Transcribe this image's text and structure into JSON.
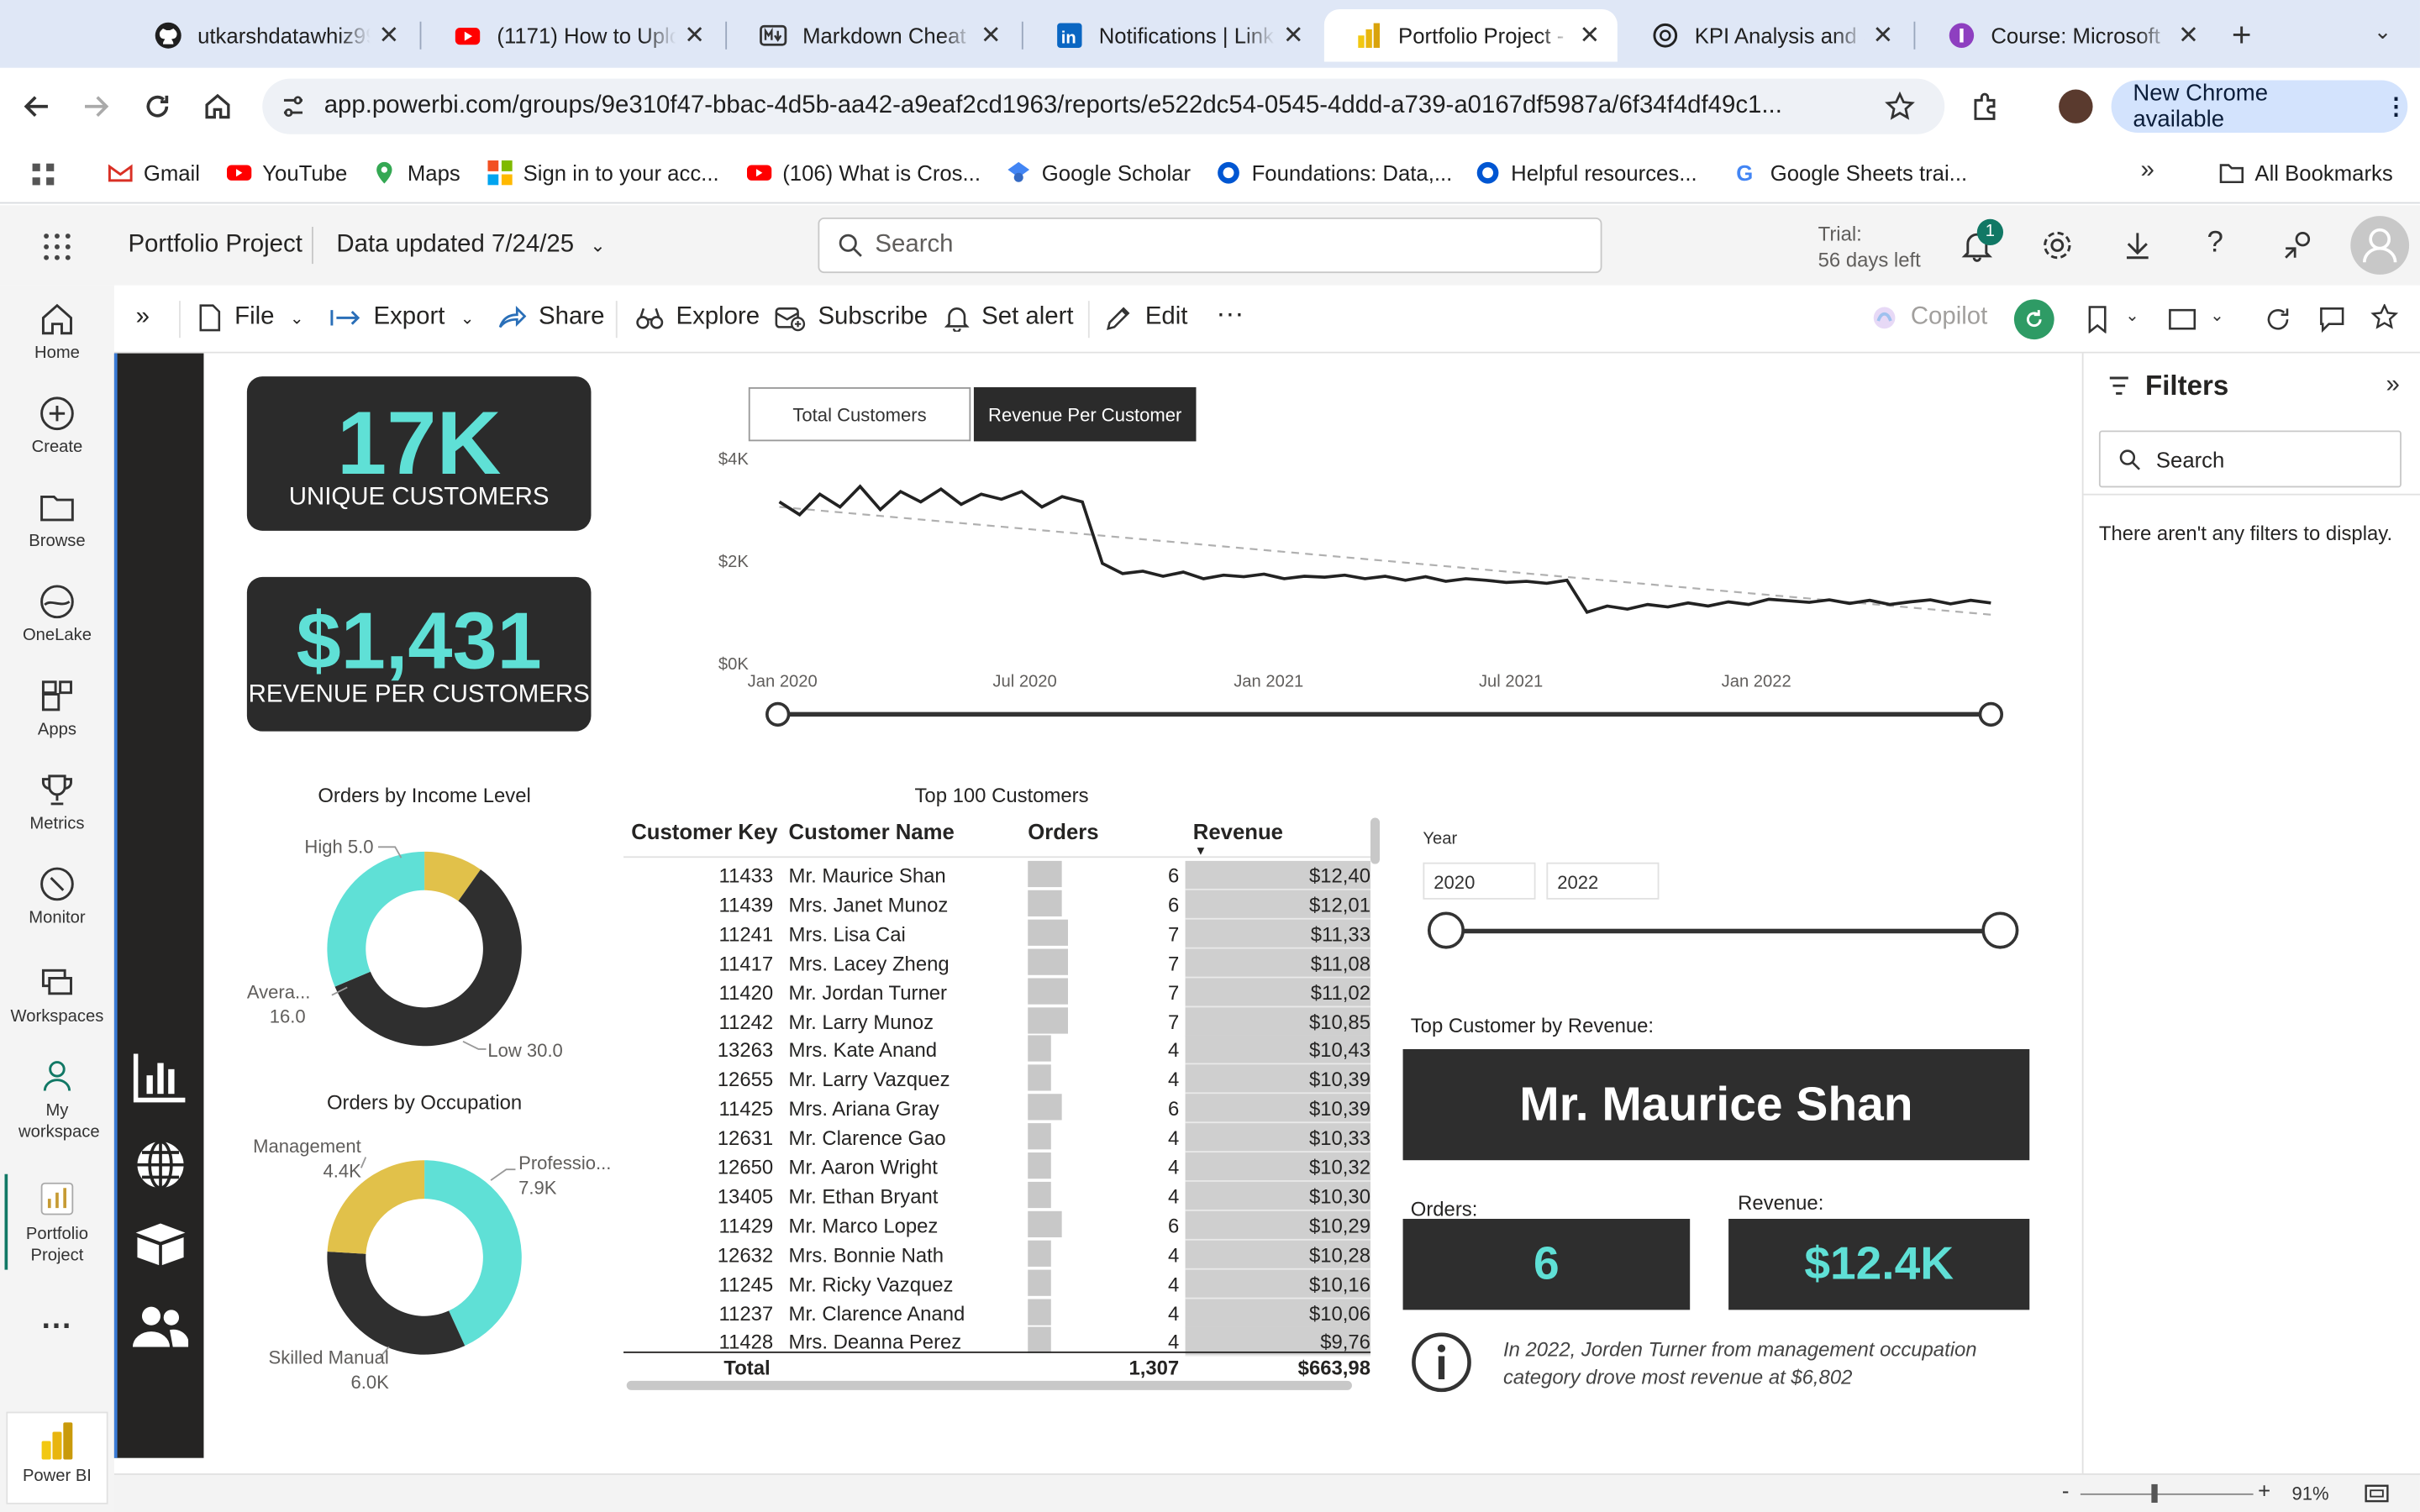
{
  "browser": {
    "tabs": [
      {
        "title": "utkarshdatawhiz99",
        "icon": "github-icon"
      },
      {
        "title": "(1171) How to Uplo",
        "icon": "youtube-icon"
      },
      {
        "title": "Markdown Cheat S",
        "icon": "markdown-icon"
      },
      {
        "title": "Notifications | Link",
        "icon": "linkedin-icon"
      },
      {
        "title": "Portfolio Project - P",
        "icon": "powerbi-icon",
        "active": true
      },
      {
        "title": "KPI Analysis and S",
        "icon": "openai-icon"
      },
      {
        "title": "Course: Microsoft",
        "icon": "course-icon"
      }
    ],
    "url": "app.powerbi.com/groups/9e310f47-bbac-4d5b-aa42-a9eaf2cd1963/reports/e522dc54-0545-4ddd-a739-a0167df5987a/6f34f4df49c1...",
    "new_chrome": "New Chrome available",
    "bookmarks": [
      "Gmail",
      "YouTube",
      "Maps",
      "Sign in to your acc...",
      "(106) What is Cros...",
      "Google Scholar",
      "Foundations: Data,...",
      "Helpful resources...",
      "Google Sheets trai..."
    ],
    "all_bookmarks": "All Bookmarks"
  },
  "pbi": {
    "workspace": "Portfolio Project",
    "data_updated": "Data updated 7/24/25",
    "search_placeholder": "Search",
    "trial_line1": "Trial:",
    "trial_line2": "56 days left",
    "notif_count": "1",
    "nav": [
      "Home",
      "Create",
      "Browse",
      "OneLake",
      "Apps",
      "Metrics",
      "Monitor",
      "Workspaces",
      "My workspace",
      "Portfolio Project",
      "Power BI"
    ],
    "toolbar": {
      "file": "File",
      "export": "Export",
      "share": "Share",
      "explore": "Explore",
      "subscribe": "Subscribe",
      "set_alert": "Set alert",
      "edit": "Edit",
      "copilot": "Copilot"
    }
  },
  "report": {
    "kpi1": {
      "value": "17K",
      "label": "UNIQUE CUSTOMERS"
    },
    "kpi2": {
      "value": "$1,431",
      "label": "REVENUE PER CUSTOMERS"
    },
    "toggle": {
      "left": "Total Customers",
      "right": "Revenue Per Customer"
    },
    "donut1": {
      "title": "Orders by Income Level",
      "slices": [
        {
          "name": "High",
          "value": 5.0,
          "label": "High 5.0",
          "color": "#e1c14a"
        },
        {
          "name": "Low",
          "value": 30.0,
          "label": "Low 30.0",
          "color": "#2f2f2f"
        },
        {
          "name": "Average",
          "value": 16.0,
          "label_a": "Avera...",
          "label_b": "16.0",
          "color": "#5fe0d6"
        }
      ]
    },
    "donut2": {
      "title": "Orders by Occupation",
      "slices": [
        {
          "name": "Professional",
          "value": 7.9,
          "label_a": "Professio...",
          "label_b": "7.9K",
          "color": "#5fe0d6"
        },
        {
          "name": "Skilled Manual",
          "value": 6.0,
          "label_a": "Skilled Manual",
          "label_b": "6.0K",
          "color": "#2f2f2f"
        },
        {
          "name": "Management",
          "value": 4.4,
          "label_a": "Management",
          "label_b": "4.4K",
          "color": "#e1c14a"
        }
      ]
    },
    "table": {
      "title": "Top 100 Customers",
      "headers": [
        "Customer Key",
        "Customer Name",
        "Orders",
        "Revenue"
      ],
      "rows": [
        [
          "11433",
          "Mr. Maurice Shan",
          "6",
          "$12,40"
        ],
        [
          "11439",
          "Mrs. Janet Munoz",
          "6",
          "$12,01"
        ],
        [
          "11241",
          "Mrs. Lisa Cai",
          "7",
          "$11,33"
        ],
        [
          "11417",
          "Mrs. Lacey Zheng",
          "7",
          "$11,08"
        ],
        [
          "11420",
          "Mr. Jordan Turner",
          "7",
          "$11,02"
        ],
        [
          "11242",
          "Mr. Larry Munoz",
          "7",
          "$10,85"
        ],
        [
          "13263",
          "Mrs. Kate Anand",
          "4",
          "$10,43"
        ],
        [
          "12655",
          "Mr. Larry Vazquez",
          "4",
          "$10,39"
        ],
        [
          "11425",
          "Mrs. Ariana Gray",
          "6",
          "$10,39"
        ],
        [
          "12631",
          "Mr. Clarence Gao",
          "4",
          "$10,33"
        ],
        [
          "12650",
          "Mr. Aaron Wright",
          "4",
          "$10,32"
        ],
        [
          "13405",
          "Mr. Ethan Bryant",
          "4",
          "$10,30"
        ],
        [
          "11429",
          "Mr. Marco Lopez",
          "6",
          "$10,29"
        ],
        [
          "12632",
          "Mrs. Bonnie Nath",
          "4",
          "$10,28"
        ],
        [
          "11245",
          "Mr. Ricky Vazquez",
          "4",
          "$10,16"
        ],
        [
          "11237",
          "Mr. Clarence Anand",
          "4",
          "$10,06"
        ],
        [
          "11428",
          "Mrs. Deanna Perez",
          "4",
          "$9,76"
        ]
      ],
      "total_label": "Total",
      "total_orders": "1,307",
      "total_revenue": "$663,98"
    },
    "year_slicer": {
      "label": "Year",
      "from": "2020",
      "to": "2022"
    },
    "top_customer_label": "Top Customer by Revenue:",
    "top_customer": "Mr. Maurice Shan",
    "orders_label": "Orders:",
    "orders_value": "6",
    "revenue_label": "Revenue:",
    "revenue_value": "$12.4K",
    "insight": "In 2022, Jorden Turner from management occupation category drove most revenue at $6,802"
  },
  "filters": {
    "title": "Filters",
    "search": "Search",
    "empty": "There aren't any filters to display."
  },
  "status": {
    "zoom": "91%"
  },
  "chart_data": {
    "type": "line",
    "series": [
      {
        "values": [
          3150,
          2900,
          3300,
          3050,
          3450,
          3000,
          3350,
          3150,
          3400,
          3100,
          3300,
          3200,
          3350,
          3050,
          3250,
          3150,
          1950,
          1750,
          1800,
          1700,
          1780,
          1650,
          1720,
          1690,
          1740,
          1650,
          1700,
          1680,
          1720,
          1650,
          1700,
          1620,
          1690,
          1600,
          1650,
          1620,
          1580,
          1600,
          1560,
          1620,
          1000,
          1120,
          1060,
          1150,
          1100,
          1180,
          1120,
          1200,
          1150,
          1250,
          1220,
          1190,
          1240,
          1170,
          1230,
          1150,
          1200,
          1240,
          1160,
          1230,
          1180
        ]
      }
    ],
    "trend": [
      3050,
      950
    ],
    "x_ticks": [
      "Jan 2020",
      "Jul 2020",
      "Jan 2021",
      "Jul 2021",
      "Jan 2022"
    ],
    "y_ticks": [
      "$4K",
      "$2K",
      "$0K"
    ],
    "ylim": [
      0,
      4000
    ],
    "grid": false,
    "line_color": "#222222",
    "trend_color": "#b0b0b0"
  }
}
